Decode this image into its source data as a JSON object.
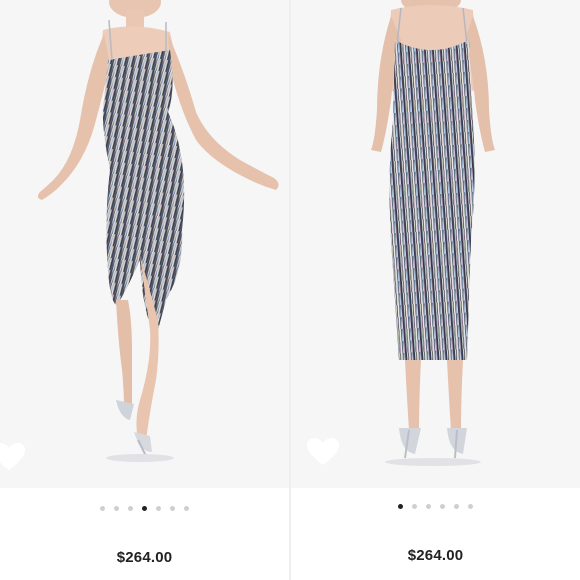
{
  "panels": [
    {
      "price": "$264.00",
      "carousel": {
        "count": 7,
        "active_index": 3
      }
    },
    {
      "price": "$264.00",
      "carousel": {
        "count": 6,
        "active_index": 0
      }
    }
  ],
  "icons": {
    "favorite": "heart-icon"
  },
  "colors": {
    "background": "#ffffff",
    "photo_bg": "#f6f6f7",
    "dot_inactive": "#cfcfcf",
    "dot_active": "#222222",
    "price_text": "#222222",
    "heart": "#ffffff"
  }
}
